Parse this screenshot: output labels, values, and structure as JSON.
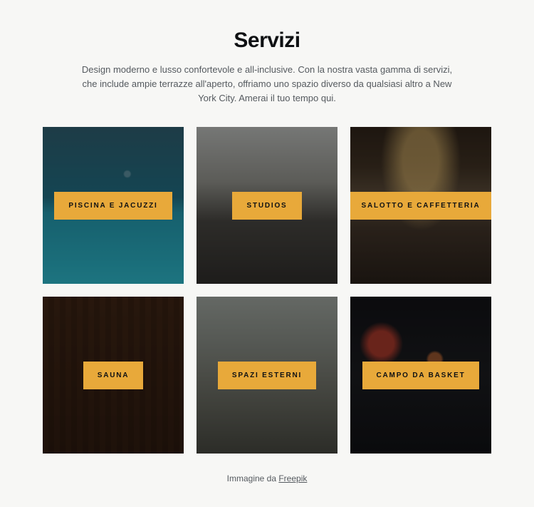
{
  "title": "Servizi",
  "description": "Design moderno e lusso confortevole e all-inclusive. Con la nostra vasta gamma di servizi, che include ampie terrazze all'aperto, offriamo uno spazio diverso da qualsiasi altro a New York City. Amerai il tuo tempo qui.",
  "cards": [
    {
      "label": "PISCINA E JACUZZI"
    },
    {
      "label": "STUDIOS"
    },
    {
      "label": "SALOTTO E CAFFETTERIA"
    },
    {
      "label": "SAUNA"
    },
    {
      "label": "SPAZI ESTERNI"
    },
    {
      "label": "CAMPO DA BASKET"
    }
  ],
  "credit": {
    "prefix": "Immagine da ",
    "link_text": "Freepik"
  }
}
